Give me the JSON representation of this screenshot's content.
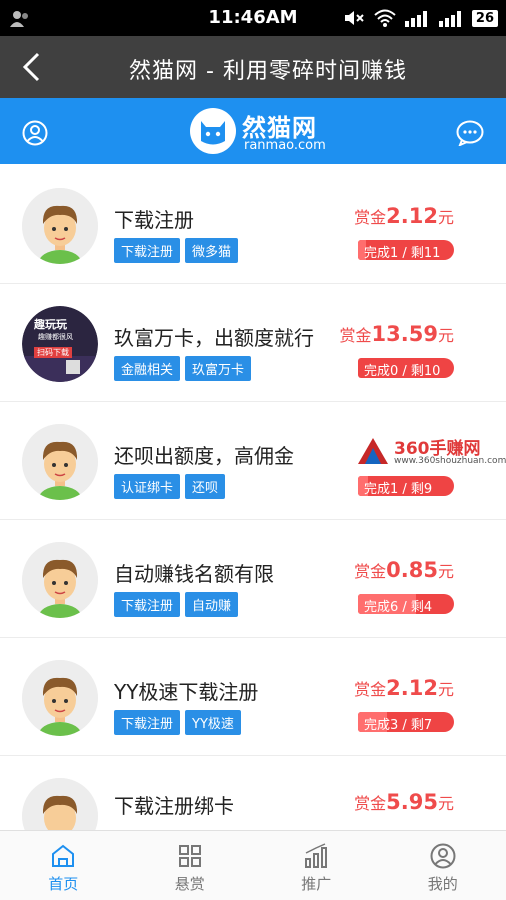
{
  "status_bar": {
    "time": "11:46AM",
    "battery": "26"
  },
  "titlebar": {
    "title": "然猫网 - 利用零碎时间赚钱"
  },
  "brand": {
    "name": "然猫网",
    "domain": "ranmao.com"
  },
  "colors": {
    "accent": "#1e90f0",
    "reward": "#ef4b4b",
    "tag": "#2a8fe6",
    "titlebar": "#404040"
  },
  "tasks": [
    {
      "name": "下载注册",
      "tags": [
        "下载注册",
        "微多猫"
      ],
      "reward_label": "赏金",
      "amount": "2.12",
      "unit": "元",
      "progress_text": "完成1 / 剩11",
      "avatar": "boy-avatar"
    },
    {
      "name": "玖富万卡，出额度就行",
      "tags": [
        "金融相关",
        "玖富万卡"
      ],
      "reward_label": "赏金",
      "amount": "13.59",
      "unit": "元",
      "progress_text": "完成0 / 剩10",
      "avatar": "poster-avatar",
      "poster": {
        "line1": "趣玩玩",
        "line2": "趣赚都很风",
        "line3": "扫码下载"
      }
    },
    {
      "name": "还呗出额度，高佣金",
      "tags": [
        "认证绑卡",
        "还呗"
      ],
      "reward_label": "",
      "amount": "",
      "unit": "",
      "progress_text": "完成1 / 剩9",
      "avatar": "boy-avatar"
    },
    {
      "name": "自动赚钱名额有限",
      "tags": [
        "下载注册",
        "自动赚"
      ],
      "reward_label": "赏金",
      "amount": "0.85",
      "unit": "元",
      "progress_text": "完成6 / 剩4",
      "avatar": "boy-avatar"
    },
    {
      "name": "YY极速下载注册",
      "tags": [
        "下载注册",
        "YY极速"
      ],
      "reward_label": "赏金",
      "amount": "2.12",
      "unit": "元",
      "progress_text": "完成3 / 剩7",
      "avatar": "boy-avatar"
    },
    {
      "name": "下载注册绑卡",
      "tags": [],
      "reward_label": "赏金",
      "amount": "5.95",
      "unit": "元",
      "progress_text": "",
      "avatar": "boy-avatar"
    }
  ],
  "watermark": {
    "name": "360手赚网",
    "url": "www.360shouzhuan.com"
  },
  "bottom_nav": [
    {
      "label": "首页",
      "icon": "home-icon",
      "active": true
    },
    {
      "label": "悬赏",
      "icon": "grid-icon",
      "active": false
    },
    {
      "label": "推广",
      "icon": "chart-icon",
      "active": false
    },
    {
      "label": "我的",
      "icon": "profile-icon",
      "active": false
    }
  ]
}
